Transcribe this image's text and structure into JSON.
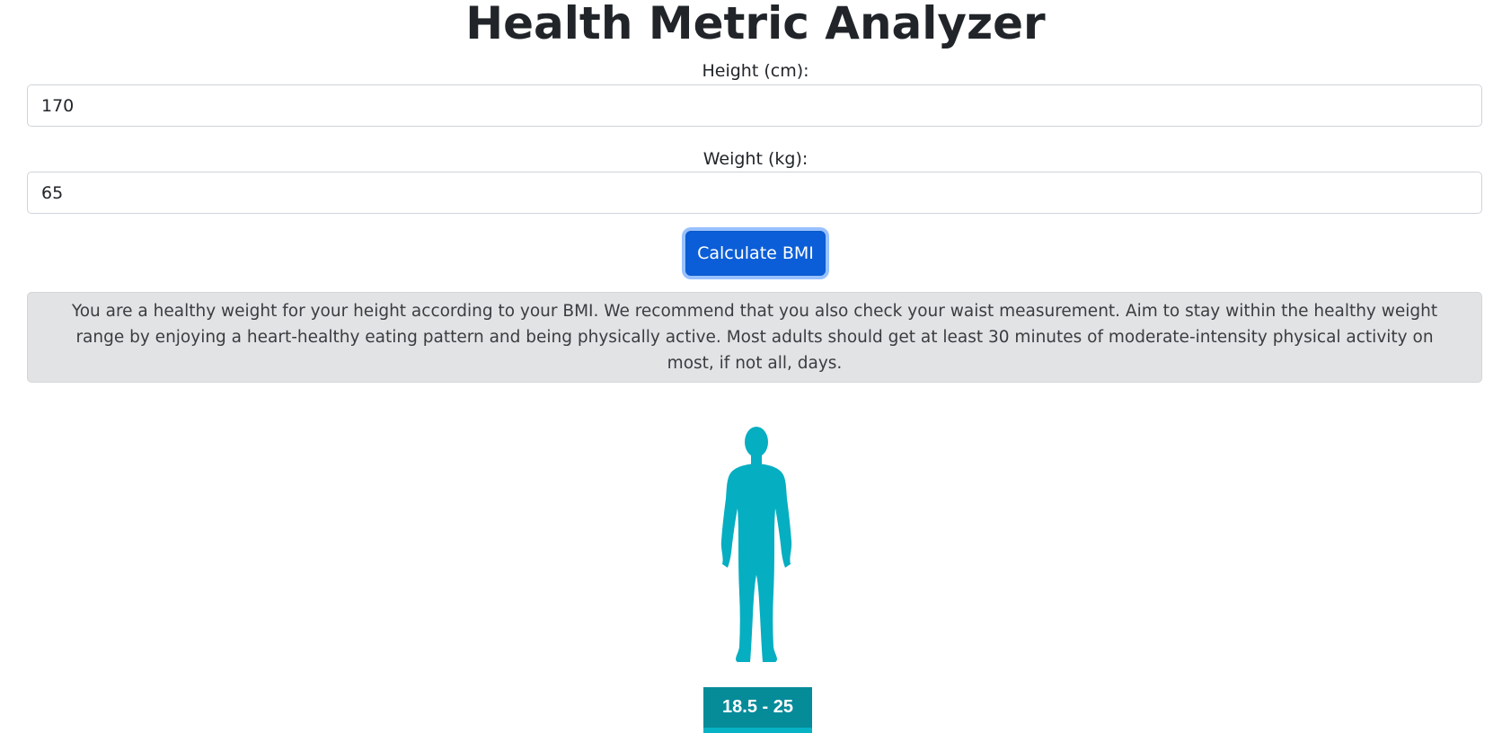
{
  "page": {
    "title": "Health Metric Analyzer"
  },
  "form": {
    "height_label": "Height (cm):",
    "height_value": "170",
    "weight_label": "Weight (kg):",
    "weight_value": "65",
    "calculate_label": "Calculate BMI"
  },
  "result": {
    "message": "You are a healthy weight for your height according to your BMI. We recommend that you also check your waist measurement. Aim to stay within the healthy weight range by enjoying a heart-healthy eating pattern and being physically active. Most adults should get at least 30 minutes of moderate-intensity physical activity on most, if not all, days.",
    "range_label": "18.5 - 25",
    "figure_icon": "healthy-body-figure-icon",
    "figure_color": "#06aec1",
    "badge_color": "#068b99"
  },
  "colors": {
    "primary_button": "#0b5ed7",
    "alert_background": "#e2e3e5"
  }
}
